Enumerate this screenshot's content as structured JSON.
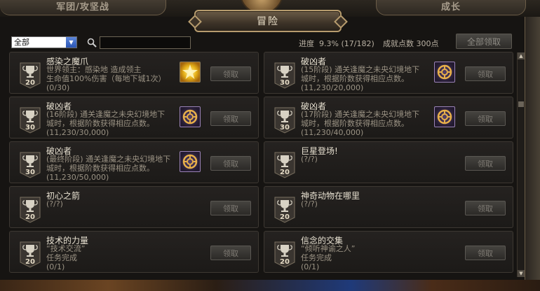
{
  "tabs": {
    "left": "军团/攻坚战",
    "active": "冒险",
    "right": "成长"
  },
  "filter": {
    "selected": "全部",
    "search_placeholder": ""
  },
  "progress": {
    "label": "进度",
    "percent": "9.3%",
    "count": "(17/182)",
    "points_label": "成就点数",
    "points_value": "300点"
  },
  "claim_all_label": "全部领取",
  "achievements": [
    {
      "points": "20",
      "title": "感染之魔爪",
      "desc": [
        "世界领主：感染地        造成领主",
        "生命值100%伤害（每地下城1次）",
        "(0/30)"
      ],
      "reward": "star",
      "claim": "领取"
    },
    {
      "points": "30",
      "title": "破凶者",
      "desc": [
        "(15阶段) 通关逢魔之未央幻境地下",
        "城时，根据阶数获得相应点数。",
        "(11,230/20,000)"
      ],
      "reward": "medal",
      "claim": "领取"
    },
    {
      "points": "30",
      "title": "破凶者",
      "desc": [
        "(16阶段) 通关逢魔之未央幻境地下",
        "城时，根据阶数获得相应点数。",
        "(11,230/30,000)"
      ],
      "reward": "medal",
      "claim": "领取"
    },
    {
      "points": "30",
      "title": "破凶者",
      "desc": [
        "(17阶段) 通关逢魔之未央幻境地下",
        "城时，根据阶数获得相应点数。",
        "(11,230/40,000)"
      ],
      "reward": "medal",
      "claim": "领取"
    },
    {
      "points": "30",
      "title": "破凶者",
      "desc": [
        "(最终阶段) 通关逢魔之未央幻境地下",
        "城时，根据阶数获得相应点数。",
        "(11,230/50,000)"
      ],
      "reward": "medal",
      "claim": "领取"
    },
    {
      "points": "20",
      "title": "巨星登场!",
      "desc": [
        "(?/?)"
      ],
      "reward": "",
      "claim": "领取"
    },
    {
      "points": "20",
      "title": "初心之箭",
      "desc": [
        "(?/?)"
      ],
      "reward": "",
      "claim": "领取"
    },
    {
      "points": "20",
      "title": "神奇动物在哪里",
      "desc": [
        "(?/?)"
      ],
      "reward": "",
      "claim": "领取"
    },
    {
      "points": "20",
      "title": "技术的力量",
      "desc": [
        "“技术交流”",
        "任务完成",
        "(0/1)"
      ],
      "reward": "",
      "claim": "领取"
    },
    {
      "points": "20",
      "title": "信念的交集",
      "desc": [
        "“倾听神谕之人”",
        "任务完成",
        "(0/1)"
      ],
      "reward": "",
      "claim": "领取"
    }
  ]
}
